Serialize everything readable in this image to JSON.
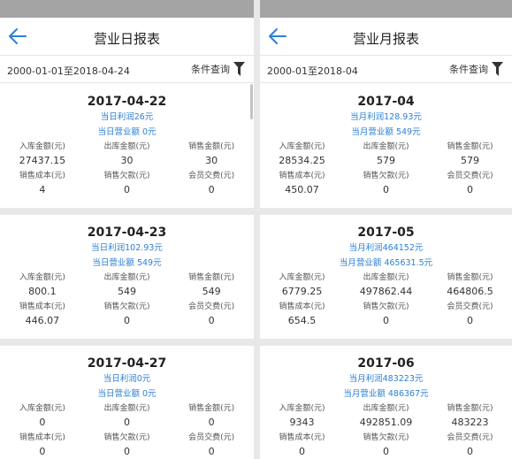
{
  "daily": {
    "title": "营业日报表",
    "date_range": "2000-01-01至2018-04-24",
    "filter_label": "条件查询",
    "labels": [
      "入库金额(元)",
      "出库金额(元)",
      "销售金额(元)",
      "销售成本(元)",
      "销售欠款(元)",
      "会员交费(元)"
    ],
    "cards": [
      {
        "date": "2017-04-22",
        "profit": "当日利润26元",
        "revenue": "当日营业额 0元",
        "values": [
          "27437.15",
          "30",
          "30",
          "4",
          "0",
          "0"
        ]
      },
      {
        "date": "2017-04-23",
        "profit": "当日利润102.93元",
        "revenue": "当日营业额 549元",
        "values": [
          "800.1",
          "549",
          "549",
          "446.07",
          "0",
          "0"
        ]
      },
      {
        "date": "2017-04-27",
        "profit": "当日利润0元",
        "revenue": "当日营业额 0元",
        "values": [
          "0",
          "0",
          "0",
          "0",
          "0",
          "0"
        ]
      }
    ]
  },
  "monthly": {
    "title": "营业月报表",
    "date_range": "2000-01至2018-04",
    "filter_label": "条件查询",
    "labels": [
      "入库金额(元)",
      "出库金额(元)",
      "销售金额(元)",
      "销售成本(元)",
      "销售欠款(元)",
      "会员交费(元)"
    ],
    "cards": [
      {
        "date": "2017-04",
        "profit": "当月利润128.93元",
        "revenue": "当月营业额 549元",
        "values": [
          "28534.25",
          "579",
          "579",
          "450.07",
          "0",
          "0"
        ]
      },
      {
        "date": "2017-05",
        "profit": "当月利润464152元",
        "revenue": "当月营业额 465631.5元",
        "values": [
          "6779.25",
          "497862.44",
          "464806.5",
          "654.5",
          "0",
          "0"
        ]
      },
      {
        "date": "2017-06",
        "profit": "当月利润483223元",
        "revenue": "当月营业额 486367元",
        "values": [
          "9343",
          "492851.09",
          "483223",
          "0",
          "0",
          "0"
        ]
      }
    ]
  },
  "colors": {
    "accent": "#2c7fd6",
    "statusbar": "#a4a4a4",
    "background": "#e8e8e8"
  },
  "icons": {
    "back": "arrow-left-icon",
    "filter": "funnel-icon"
  }
}
